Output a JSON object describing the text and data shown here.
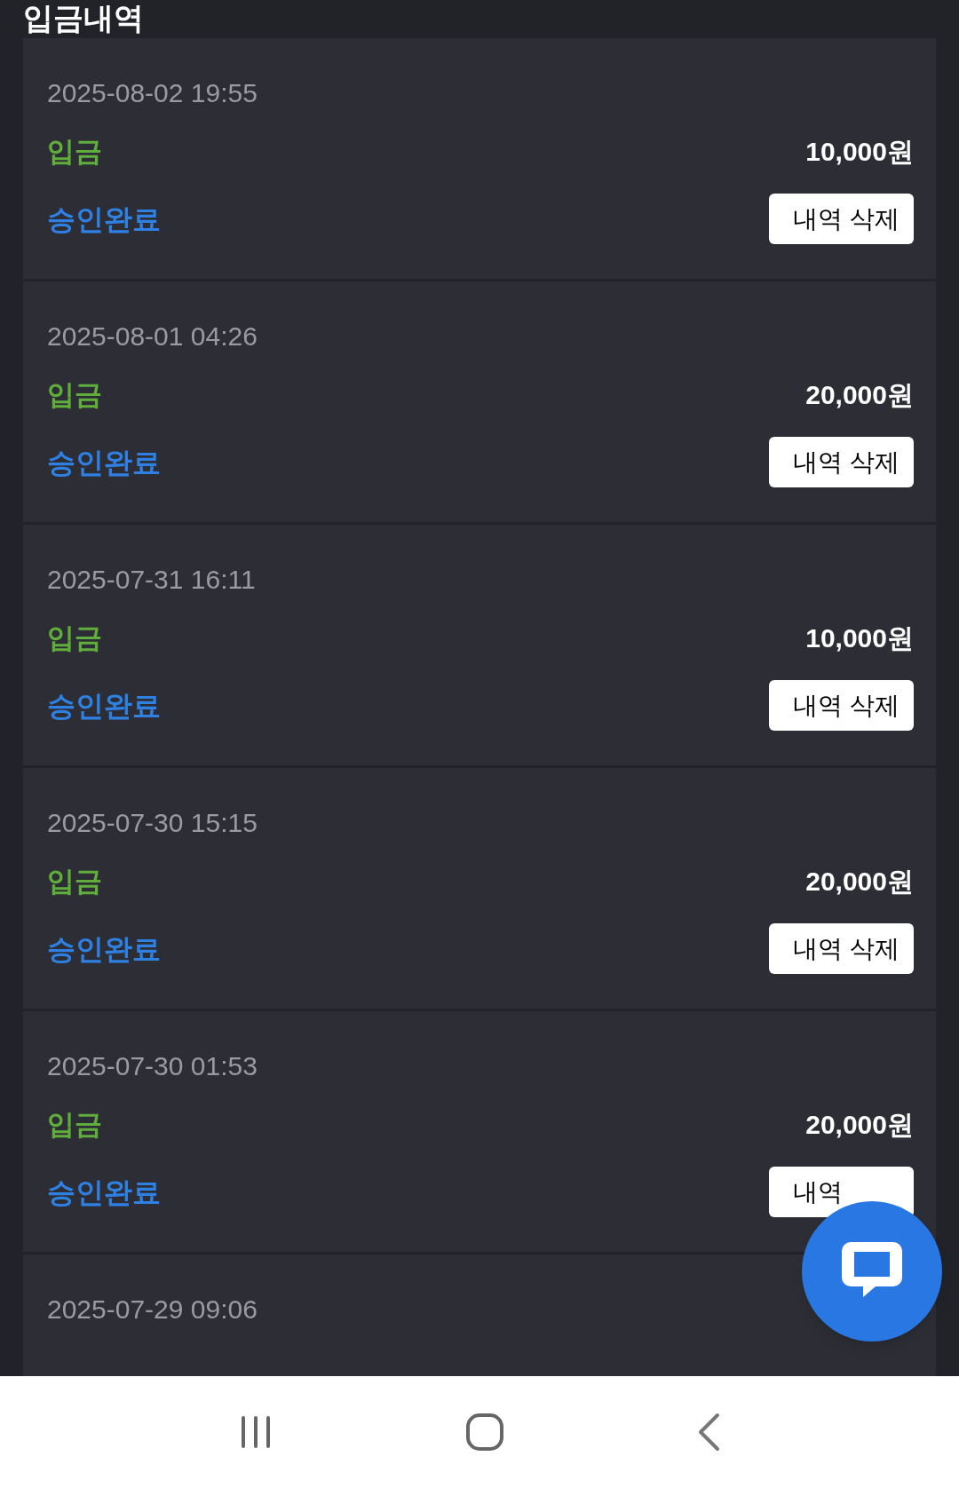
{
  "title": "입금내역",
  "entries": [
    {
      "date": "2025-08-02 19:55",
      "type": "입금",
      "amount": "10,000원",
      "status": "승인완료",
      "button": "내역 삭제"
    },
    {
      "date": "2025-08-01 04:26",
      "type": "입금",
      "amount": "20,000원",
      "status": "승인완료",
      "button": "내역 삭제"
    },
    {
      "date": "2025-07-31 16:11",
      "type": "입금",
      "amount": "10,000원",
      "status": "승인완료",
      "button": "내역 삭제"
    },
    {
      "date": "2025-07-30 15:15",
      "type": "입금",
      "amount": "20,000원",
      "status": "승인완료",
      "button": "내역 삭제"
    },
    {
      "date": "2025-07-30 01:53",
      "type": "입금",
      "amount": "20,000원",
      "status": "승인완료",
      "button": "내역"
    },
    {
      "date": "2025-07-29 09:06"
    }
  ]
}
